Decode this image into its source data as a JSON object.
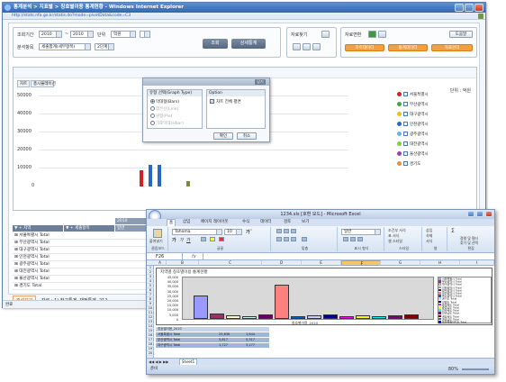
{
  "ie": {
    "title": "통계분석 > 지표별 > 칭호별이용 통계현황 - Windows Internet Explorer",
    "address": "http://stats.nfa.go.kr/statis.do?mode=pivotData&code=C3",
    "status": "완료"
  },
  "search": {
    "period_label": "조회기간",
    "start_year": "2010",
    "separator": "~",
    "end_year": "2010",
    "unit_label": "단위",
    "unit_value": "억원",
    "analysis_label": "분석항목",
    "analysis_value": "세출합계(세부항목)",
    "sub_value": "2단계",
    "query_button": "조회",
    "detail_button": "상세통계"
  },
  "tools": {
    "label": "자료찾기"
  },
  "prints": {
    "label": "자료변환",
    "help_button": "도움말",
    "buttons": [
      "차트데이터",
      "통계데이터",
      "자료관리"
    ]
  },
  "chart": {
    "unit_text": "단위 : 억원",
    "tabs": [
      "차트",
      "총시뮬레이션"
    ],
    "yticks": [
      "50000",
      "40000",
      "30000",
      "20000",
      "10000",
      "0"
    ],
    "legend": [
      {
        "label": "서울특별시",
        "color": "#d62020"
      },
      {
        "label": "부산광역시",
        "color": "#3ea83e"
      },
      {
        "label": "대구광역시",
        "color": "#e8c020"
      },
      {
        "label": "인천광역시",
        "color": "#2a66c8"
      },
      {
        "label": "광주광역시",
        "color": "#60b8e0"
      },
      {
        "label": "대전광역시",
        "color": "#7ad040"
      },
      {
        "label": "울산광역시",
        "color": "#a040b0"
      },
      {
        "label": "경기도",
        "color": "#f09030"
      }
    ]
  },
  "dialog": {
    "close_label": "닫기",
    "group1_title": "유형 선택(Graph Type)",
    "options": [
      {
        "label": "막대형(Bars)",
        "selected": true,
        "enabled": true
      },
      {
        "label": "꺾은선(Line)",
        "selected": false,
        "enabled": false
      },
      {
        "label": "원형(Pie)",
        "selected": false,
        "enabled": false
      },
      {
        "label": "가로막대(Hbar)",
        "selected": false,
        "enabled": false
      }
    ],
    "group2_title": "Option",
    "check_label": "차트 전체 평면",
    "ok": "확인",
    "cancel": "취소"
  },
  "table": {
    "col1": "▼ + 지역",
    "col2": "▼ + 세출항목",
    "col3": "2010",
    "col3b": "일반",
    "rows": [
      "⊞ 서울특별시 Total",
      "⊞ 부산광역시 Total",
      "⊞ 대구광역시 Total",
      "⊞ 인천광역시 Total",
      "⊞ 광주광역시 Total",
      "⊞ 대전광역시 Total",
      "⊞ 울산광역시 Total",
      "⊞ 경기도 Total"
    ],
    "footer_tag": "주석보기",
    "footer_text": "자료 : 1) 참고통계, 재정통계, 212"
  },
  "excel": {
    "title": "1234.xls [호환 모드] - Microsoft Excel",
    "tabs": [
      "홈",
      "삽입",
      "페이지 레이아웃",
      "수식",
      "데이터",
      "검토",
      "보기"
    ],
    "font_name": "Tahoma",
    "font_size": "10",
    "number_format": "일반",
    "ribbon_labels": [
      "클립보드",
      "글꼴",
      "맞춤",
      "표시 형식",
      "스타일",
      "셀",
      "편집"
    ],
    "paste": "붙여넣기",
    "insert": "삽입",
    "delete": "삭제",
    "format": "서식",
    "cond_format": "조건부 서식",
    "table_format": "표 서식",
    "cell_style": "셀 스타일",
    "sort": "정렬 및 필터",
    "find": "찾기 및 선택",
    "namebox": "F26",
    "fx": "fx",
    "columns": [
      "A",
      "B",
      "C",
      "D",
      "E",
      "F",
      "G",
      "H",
      "I"
    ],
    "row_numbers": [
      "1",
      "2",
      "3",
      "4",
      "5",
      "6",
      "7",
      "8",
      "9",
      "10",
      "11",
      "12",
      "13",
      "14",
      "15",
      "16",
      "17",
      "18",
      "19",
      "20"
    ],
    "chart_title": "지역별 칭호별이용 통계현황",
    "chart_yticks": [
      "45,000",
      "40,000",
      "35,000",
      "30,000",
      "25,000",
      "20,000",
      "15,000",
      "10,000",
      "5,000",
      "0"
    ],
    "chart_xlabel": "칭호별이용_2010",
    "chart_legend": [
      {
        "label": "서울특별시 Total",
        "color": "#9999ff"
      },
      {
        "label": "부산광역시 Total",
        "color": "#993366"
      },
      {
        "label": "대구광역시 Total",
        "color": "#ffffcc"
      },
      {
        "label": "인천광역시 Total",
        "color": "#ccffff"
      },
      {
        "label": "광주광역시 Total",
        "color": "#660066"
      },
      {
        "label": "대전광역시 Total",
        "color": "#ff8080"
      },
      {
        "label": "울산광역시 Total",
        "color": "#0066cc"
      },
      {
        "label": "경기도 Total",
        "color": "#ccccff"
      },
      {
        "label": "강원도 Total",
        "color": "#000080"
      },
      {
        "label": "충청북도 Total",
        "color": "#ff00ff"
      },
      {
        "label": "충청남도 Total",
        "color": "#ffff00"
      },
      {
        "label": "전라북도 Total",
        "color": "#00ffff"
      },
      {
        "label": "전라남도 Total",
        "color": "#800080"
      },
      {
        "label": "경상북도 Total",
        "color": "#800000"
      },
      {
        "label": "경상남도 Total",
        "color": "#008080"
      },
      {
        "label": "제주특별자치도 Total",
        "color": "#0000ff"
      }
    ],
    "pivot_header": [
      "칭호별이용_2010",
      "",
      ""
    ],
    "pivot_rows": [
      [
        "서울특별시 Total",
        "25,836",
        "1,644"
      ],
      [
        "부산광역시 Total",
        "5,817",
        "5,317"
      ],
      [
        "대구광역시 Total",
        "1,727",
        "3,177"
      ]
    ],
    "sheet_tab": "Sheet1",
    "status": "준비",
    "zoom": "80%"
  }
}
